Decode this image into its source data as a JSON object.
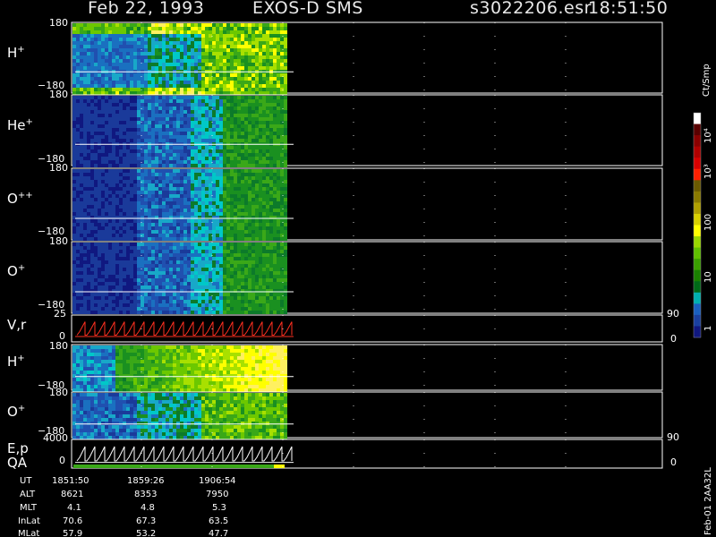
{
  "header": {
    "date": "Feb 22, 1993",
    "instrument": "EXOS-D SMS",
    "file": "s3022206.esr",
    "time": "18:51:50"
  },
  "colorbar": {
    "units": "Ct/Smp",
    "tick_labels": [
      "10⁴",
      "10³",
      "100",
      "10",
      "1"
    ],
    "colors": [
      "#ffffff",
      "#5a0000",
      "#8a0000",
      "#b00000",
      "#d80000",
      "#ff2000",
      "#6b5a00",
      "#8a7a00",
      "#b0a000",
      "#d8d000",
      "#ffff00",
      "#9ad800",
      "#60c000",
      "#3aa000",
      "#1a8000",
      "#006a18",
      "#00b0b0",
      "#1a60c0",
      "#1a40a0",
      "#101880"
    ]
  },
  "panels": [
    {
      "label": "H",
      "charge": "+",
      "top": "180",
      "bottom": "−180",
      "type": "spectrogram"
    },
    {
      "label": "He",
      "charge": "+",
      "top": "180",
      "bottom": "−180",
      "type": "spectrogram"
    },
    {
      "label": "O",
      "charge": "++",
      "top": "180",
      "bottom": "−180",
      "type": "spectrogram"
    },
    {
      "label": "O",
      "charge": "+",
      "top": "180",
      "bottom": "−180",
      "type": "spectrogram"
    },
    {
      "label": "V,r",
      "charge": "",
      "top": "25",
      "bottom": "0",
      "right_top": "90",
      "right_bottom": "0",
      "type": "sawtooth"
    },
    {
      "label": "H",
      "charge": "+",
      "top": "180",
      "bottom": "−180",
      "type": "spectrogram"
    },
    {
      "label": "O",
      "charge": "+",
      "top": "180",
      "bottom": "−180",
      "type": "spectrogram"
    },
    {
      "label": "E,p",
      "label2": "QA",
      "charge": "",
      "top": "4000",
      "bottom": "0",
      "right_top": "90",
      "right_bottom": "0",
      "type": "sawtooth"
    }
  ],
  "ephemeris": {
    "rows": [
      {
        "name": "UT",
        "values": [
          "1851:50",
          "1859:26",
          "1906:54"
        ]
      },
      {
        "name": "ALT",
        "values": [
          "8621",
          "8353",
          "7950"
        ]
      },
      {
        "name": "MLT",
        "values": [
          "4.1",
          "4.8",
          "5.3"
        ]
      },
      {
        "name": "InLat",
        "values": [
          "70.6",
          "67.3",
          "63.5"
        ]
      },
      {
        "name": "MLat",
        "values": [
          "57.9",
          "53.2",
          "47.7"
        ]
      }
    ]
  },
  "footer": {
    "version": "Feb-01 2AA32L"
  },
  "chart_data": {
    "type": "heatmap",
    "title": "Feb 22, 1993   EXOS-D SMS",
    "xlabel": "UT",
    "x_ticks": [
      "1851:50",
      "1859:26",
      "1906:54"
    ],
    "colorbar_label": "Ct/Smp",
    "colorbar_range": [
      1,
      10000
    ],
    "colorbar_scale": "log",
    "series": [
      {
        "name": "H+",
        "ylim": [
          -180,
          180
        ],
        "dominant_levels": [
          "1",
          "10",
          "100"
        ]
      },
      {
        "name": "He+",
        "ylim": [
          -180,
          180
        ],
        "dominant_levels": [
          "1",
          "10"
        ]
      },
      {
        "name": "O++",
        "ylim": [
          -180,
          180
        ],
        "dominant_levels": [
          "1",
          "10"
        ]
      },
      {
        "name": "O+",
        "ylim": [
          -180,
          180
        ],
        "dominant_levels": [
          "1",
          "10"
        ]
      },
      {
        "name": "V,r",
        "ylim": [
          0,
          25
        ],
        "ylim_right": [
          0,
          90
        ]
      },
      {
        "name": "H+",
        "ylim": [
          -180,
          180
        ],
        "dominant_levels": [
          "10",
          "100"
        ]
      },
      {
        "name": "O+",
        "ylim": [
          -180,
          180
        ],
        "dominant_levels": [
          "10",
          "100"
        ]
      },
      {
        "name": "E,p",
        "ylim": [
          0,
          4000
        ],
        "ylim_right": [
          0,
          90
        ]
      }
    ]
  }
}
